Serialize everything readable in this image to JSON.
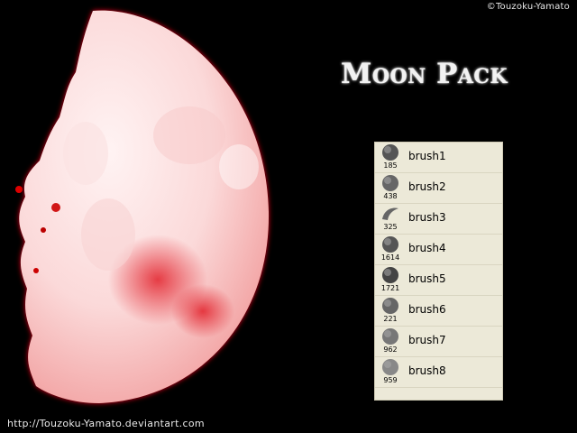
{
  "copyright": "©Touzoku-Yamato",
  "title": "Moon Pack",
  "footer_url": "http://Touzoku-Yamato.deviantart.com",
  "colors": {
    "background": "#000000",
    "moon_highlight": "#fde8e8",
    "moon_glow": "#e0101a",
    "panel": "#ece9d8"
  },
  "brushes": [
    {
      "name": "brush1",
      "size": "185",
      "icon": "moon-thumb-icon"
    },
    {
      "name": "brush2",
      "size": "438",
      "icon": "moon-thumb-icon"
    },
    {
      "name": "brush3",
      "size": "325",
      "icon": "crescent-thumb-icon"
    },
    {
      "name": "brush4",
      "size": "1614",
      "icon": "moon-thumb-icon"
    },
    {
      "name": "brush5",
      "size": "1721",
      "icon": "moon-thumb-icon"
    },
    {
      "name": "brush6",
      "size": "221",
      "icon": "moon-thumb-icon"
    },
    {
      "name": "brush7",
      "size": "962",
      "icon": "moon-thumb-icon"
    },
    {
      "name": "brush8",
      "size": "959",
      "icon": "moon-thumb-icon"
    }
  ]
}
